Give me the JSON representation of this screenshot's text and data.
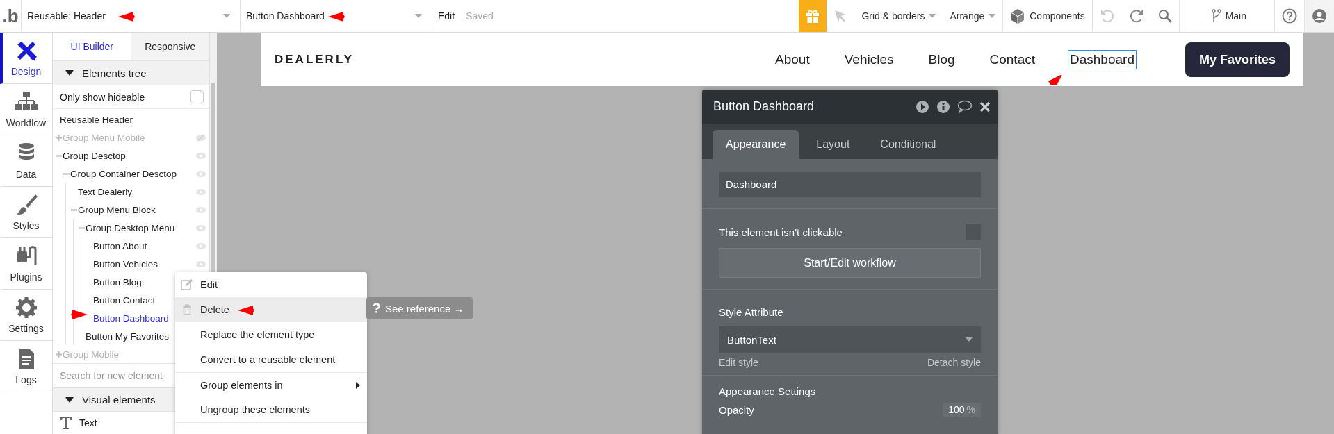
{
  "topbar": {
    "logo": ".b",
    "page_dropdown": "Reusable: Header",
    "element_dropdown": "Button Dashboard",
    "edit": "Edit",
    "status": "Saved",
    "grid": "Grid & borders",
    "arrange": "Arrange",
    "components": "Components",
    "branch": "Main"
  },
  "nav": [
    {
      "label": "Design",
      "kind": "design",
      "selected": true
    },
    {
      "label": "Workflow",
      "kind": "workflow",
      "selected": false
    },
    {
      "label": "Data",
      "kind": "data",
      "selected": false
    },
    {
      "label": "Styles",
      "kind": "styles",
      "selected": false
    },
    {
      "label": "Plugins",
      "kind": "plugins",
      "selected": false
    },
    {
      "label": "Settings",
      "kind": "settings",
      "selected": false
    },
    {
      "label": "Logs",
      "kind": "logs",
      "selected": false
    }
  ],
  "tree_panel": {
    "tabs": [
      {
        "label": "UI Builder",
        "selected": true
      },
      {
        "label": "Responsive",
        "selected": false
      }
    ],
    "section": {
      "label": "Elements tree",
      "expanded": true
    },
    "filter": {
      "label": "Only show hideable",
      "checked": false
    },
    "root": "Reusable Header",
    "items": [
      {
        "label": "Group Menu Mobile",
        "hidden": true,
        "expanded": false,
        "selected": false
      },
      {
        "label": "Group Desctop",
        "hidden": false,
        "expanded": true,
        "selected": false,
        "children": [
          {
            "label": "Group Container Desctop",
            "hidden": false,
            "expanded": true,
            "selected": false,
            "children": [
              {
                "label": "Text Dealerly",
                "hidden": false,
                "selected": false
              },
              {
                "label": "Group Menu Block",
                "hidden": false,
                "expanded": true,
                "selected": false,
                "children": [
                  {
                    "label": "Group Desktop Menu",
                    "hidden": false,
                    "expanded": true,
                    "selected": false,
                    "children": [
                      {
                        "label": "Button About",
                        "hidden": false,
                        "selected": false
                      },
                      {
                        "label": "Button Vehicles",
                        "hidden": false,
                        "selected": false
                      },
                      {
                        "label": "Button Blog",
                        "hidden": false,
                        "selected": false
                      },
                      {
                        "label": "Button Contact",
                        "hidden": false,
                        "selected": false
                      },
                      {
                        "label": "Button Dashboard",
                        "hidden": false,
                        "selected": true
                      }
                    ]
                  },
                  {
                    "label": "Button My Favorites",
                    "hidden": false,
                    "selected": false
                  }
                ]
              }
            ]
          }
        ]
      },
      {
        "label": "Group Mobile",
        "hidden": true,
        "expanded": false,
        "selected": false
      }
    ],
    "search": {
      "placeholder": "Search for new element"
    },
    "visual_section": {
      "label": "Visual elements",
      "expanded": true
    },
    "visual_items": [
      {
        "label": "Text"
      }
    ]
  },
  "header_preview": {
    "logo": "DEALERLY",
    "links": [
      {
        "label": "About",
        "selected": false
      },
      {
        "label": "Vehicles",
        "selected": false
      },
      {
        "label": "Blog",
        "selected": false
      },
      {
        "label": "Contact",
        "selected": false
      },
      {
        "label": "Dashboard",
        "selected": true
      }
    ],
    "cta": "My Favorites"
  },
  "property_panel": {
    "title": "Button Dashboard",
    "tabs": [
      {
        "label": "Appearance",
        "selected": true
      },
      {
        "label": "Layout",
        "selected": false
      },
      {
        "label": "Conditional",
        "selected": false
      }
    ],
    "text_value": "Dashboard",
    "clickable": {
      "label": "This element isn't clickable",
      "checked": false
    },
    "workflow_button": "Start/Edit workflow",
    "style": {
      "label": "Style Attribute",
      "value": "ButtonText",
      "edit": "Edit style",
      "detach": "Detach style"
    },
    "settings_title": "Appearance Settings",
    "opacity": {
      "label": "Opacity",
      "value": "100",
      "unit": "%"
    }
  },
  "context_menu": {
    "items": [
      {
        "label": "Edit",
        "kind": "edit",
        "highlighted": false,
        "divider": false,
        "submenu": false
      },
      {
        "label": "Delete",
        "kind": "delete",
        "highlighted": true,
        "divider": false,
        "submenu": false
      },
      {
        "label": "Replace the element type",
        "kind": "plain",
        "highlighted": false,
        "divider": false,
        "submenu": false
      },
      {
        "label": "Convert to a reusable element",
        "kind": "plain",
        "highlighted": false,
        "divider": false,
        "submenu": false
      },
      {
        "label": "Group elements in",
        "kind": "plain",
        "highlighted": false,
        "divider": true,
        "submenu": true
      },
      {
        "label": "Ungroup these elements",
        "kind": "plain",
        "highlighted": false,
        "divider": false,
        "submenu": false
      }
    ]
  },
  "tooltip": {
    "label": "See reference →"
  }
}
